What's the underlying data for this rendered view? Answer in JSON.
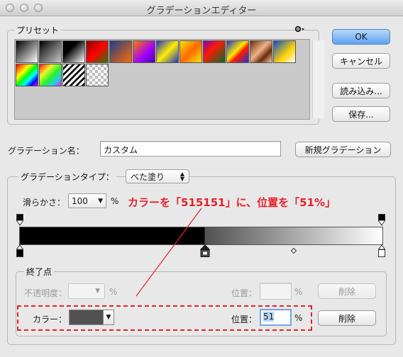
{
  "window": {
    "title": "グラデーションエディター"
  },
  "presets": {
    "label": "プリセット",
    "swatches": [
      "linear-gradient(135deg,#000 0%,#fff 100%)",
      "linear-gradient(135deg,#000 0%,rgba(0,0,0,0) 100%)",
      "linear-gradient(135deg,#000 0%,#000 35%,#fff 100%)",
      "linear-gradient(135deg,#8b0000 0%,#ff0000 50%,#2a7b00 100%)",
      "linear-gradient(135deg,#1b3e8f 0%,#ff6a00 100%)",
      "linear-gradient(135deg,#ff7a00 0%,#a000ff 60%,#4b00a8 100%)",
      "linear-gradient(135deg,#2036c8 0%,#ffee00 50%,#2036c8 100%)",
      "linear-gradient(135deg,#ffe400 0%,#ff6a00 50%,#ffe400 100%)",
      "linear-gradient(135deg,#7b00c2 0%,#ff1a00 40%,#006d2f 100%)",
      "linear-gradient(135deg,#2036c8 0%,#ffea00 45%,#ff1a00 60%,#2036c8 100%)",
      "linear-gradient(135deg,#6a2d0b 0%,#f0b28a 45%,#6a2d0b 70%,#f2c7a5 100%)",
      "linear-gradient(135deg,#0b4bd6 0%,#ffd400 60%,#ffffff 100%)",
      "linear-gradient(135deg,#ff0000 0%,#ff8000 17%,#ffff00 33%,#00ff00 50%,#00ffff 66%,#0000ff 83%,#ff00ff 100%)",
      "linear-gradient(135deg,rgba(255,0,0,0.9) 0%,rgba(255,255,0,0.8) 30%,rgba(0,255,0,0.8) 55%,rgba(0,200,255,0.8) 80%,rgba(255,0,255,0.9) 100%)",
      "repeating-linear-gradient(135deg,#ffffff 0px,#ffffff 3px,#111 3px,#111 6px)",
      "checker"
    ]
  },
  "buttons": {
    "ok": "OK",
    "cancel": "キャンセル",
    "load": "読み込み...",
    "save": "保存...",
    "new_gradient": "新規グラデーション",
    "delete_opacity": "削除",
    "delete_color": "削除"
  },
  "name_field": {
    "label": "グラデーション名：",
    "value": "カスタム"
  },
  "gradient_type": {
    "label": "グラデーションタイプ：",
    "value": "べた塗り",
    "smoothness_label": "滑らかさ：",
    "smoothness_value": "100",
    "smoothness_unit": "%"
  },
  "stops": {
    "label": "終了点",
    "opacity_label": "不透明度：",
    "opacity_unit": "%",
    "opacity_location_label": "位置：",
    "opacity_location_unit": "%",
    "color_label": "カラー：",
    "color_value": "#515151",
    "color_location_label": "位置：",
    "color_location_value": "51",
    "color_location_unit": "%"
  },
  "gradient_bar": {
    "split_percent": 51,
    "dark_color": "#000000",
    "mid_color": "#515151",
    "light_color": "#ffffff",
    "midpoint_percent": 75.5
  },
  "annotation": {
    "text": "カラーを「515151」に、位置を「51%」"
  },
  "colors": {
    "annotation": "#e8212a",
    "accent": "#5fa2ef"
  }
}
